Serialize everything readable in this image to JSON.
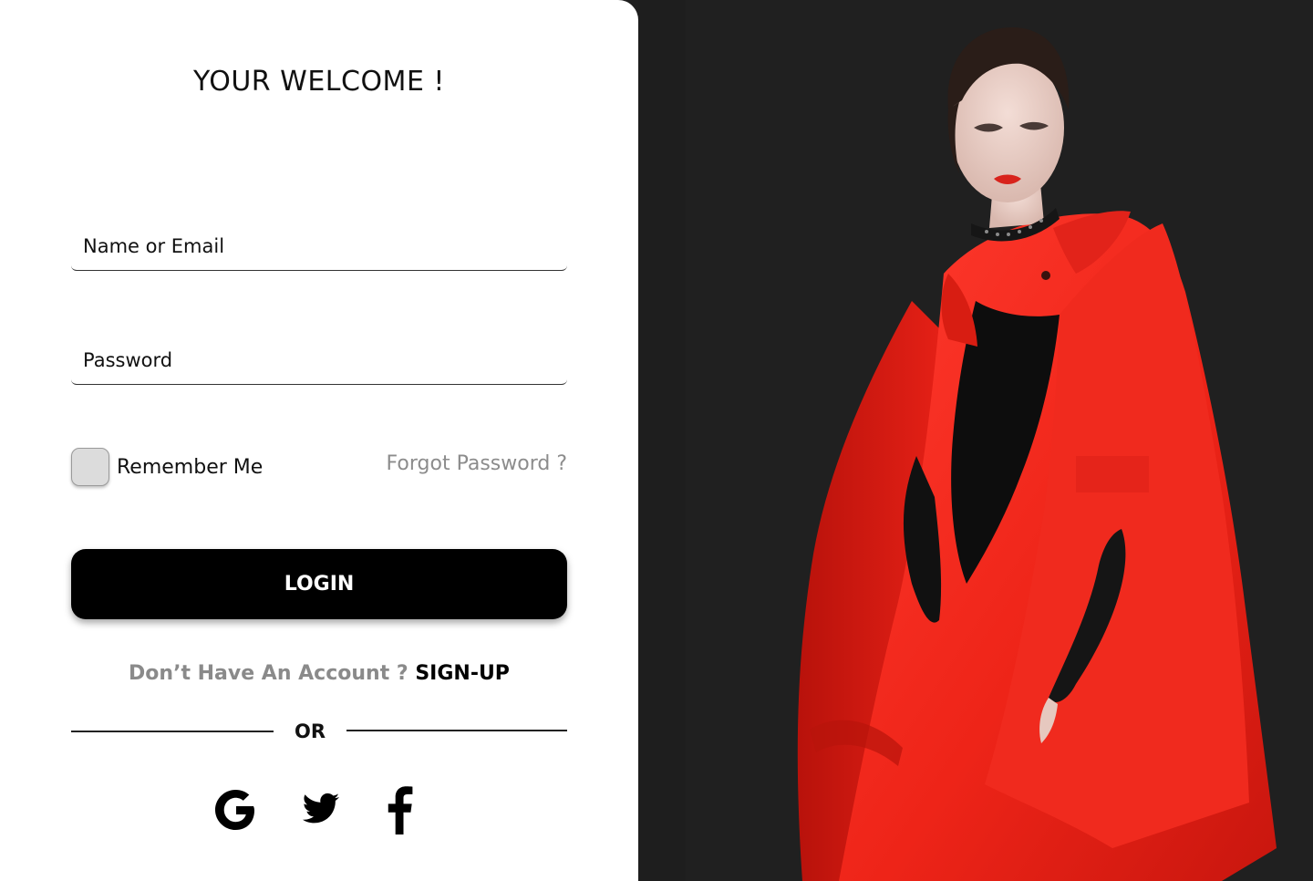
{
  "login": {
    "title": "YOUR WELCOME !",
    "name_placeholder": "Name or Email",
    "password_placeholder": "Password",
    "remember_label": "Remember Me",
    "forgot_label": "Forgot Password ?",
    "login_label": "LOGIN",
    "signup_prompt": "Don’t Have An Account ?",
    "signup_link": "SIGN-UP",
    "or_label": "OR"
  },
  "socials": [
    {
      "icon": "google-icon"
    },
    {
      "icon": "twitter-icon"
    },
    {
      "icon": "facebook-icon"
    }
  ],
  "photo": {
    "subject": "fashion model in red cape coat on dark background"
  },
  "colors": {
    "primary_button": "#000000",
    "accent_red": "#e8231b",
    "muted_text": "#8a8a8a",
    "photo_background": "#1f1f1f"
  }
}
